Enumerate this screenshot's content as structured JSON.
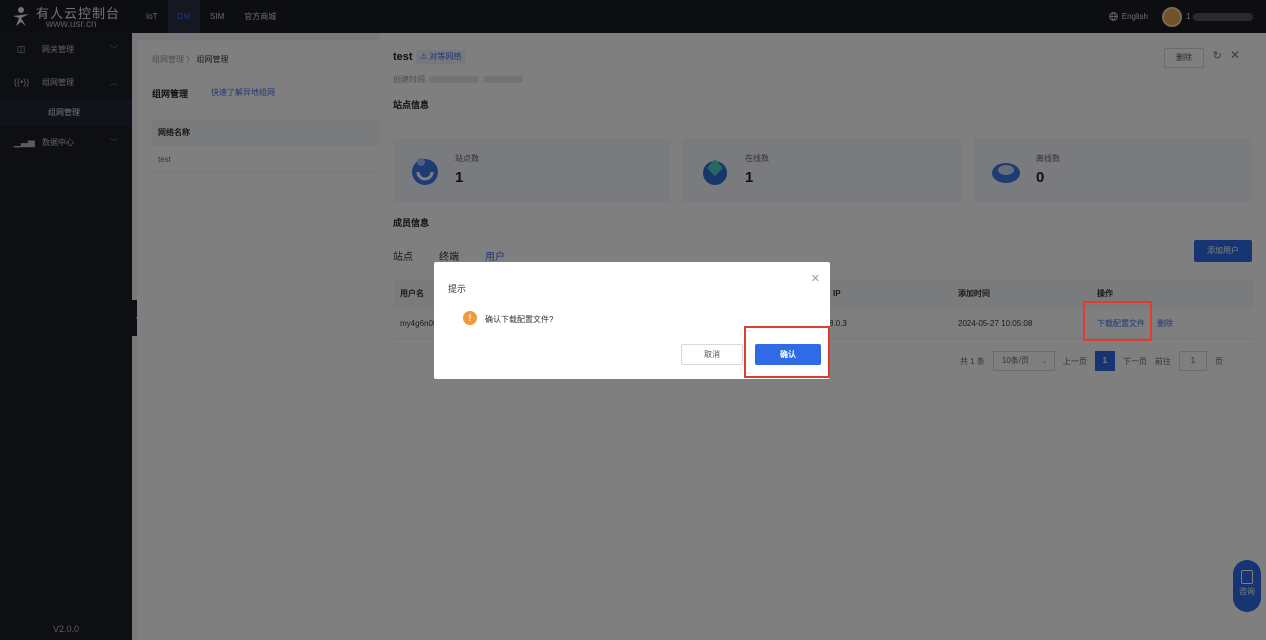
{
  "brand": {
    "title": "有人云控制台",
    "subtitle": "www.usr.cn"
  },
  "topnav": {
    "items": [
      "IoT",
      "DM",
      "SIM",
      "官方商城"
    ],
    "active": "DM"
  },
  "header": {
    "language": "English",
    "user": "1"
  },
  "sidebar": {
    "items": [
      {
        "label": "网关管理",
        "icon": "gateway-icon"
      },
      {
        "label": "组网管理",
        "icon": "network-icon"
      },
      {
        "label": "数据中心",
        "icon": "chart-icon"
      }
    ],
    "sub_item": "组网管理",
    "version": "V2.0.0"
  },
  "main": {
    "breadcrumb": [
      "组网管理",
      "组网管理"
    ],
    "title": "组网管理",
    "help_link": "快速了解异地组网",
    "list_header": "网络名称",
    "list_rows": [
      "test"
    ]
  },
  "drawer": {
    "title": "test",
    "tag": "对等网络",
    "created_label": "创建时间",
    "delete_label": "删除",
    "site_info_title": "站点信息",
    "stats": [
      {
        "label": "站点数",
        "value": "1"
      },
      {
        "label": "在线数",
        "value": "1"
      },
      {
        "label": "离线数",
        "value": "0"
      }
    ],
    "member_info_title": "成员信息",
    "tabs": [
      "站点",
      "终端",
      "用户"
    ],
    "active_tab": "用户",
    "add_user_label": "添加用户",
    "table": {
      "headers": {
        "username": "用户名",
        "ip": "IP",
        "added_time": "添加时间",
        "actions": "操作"
      },
      "rows": [
        {
          "username": "my4g6n0f",
          "ip": "8.0.3",
          "added_time": "2024-05-27 10:05:08",
          "download": "下载配置文件",
          "delete": "删除"
        }
      ]
    },
    "pagination": {
      "total": "共 1 条",
      "page_size": "10条/页",
      "prev": "上一页",
      "page": "1",
      "next": "下一页",
      "goto": "前往",
      "goto_value": "1",
      "page_unit": "页"
    }
  },
  "consult_label": "咨询",
  "dialog": {
    "title": "提示",
    "message": "确认下载配置文件?",
    "cancel": "取消",
    "confirm": "确认"
  },
  "colors": {
    "accent": "#2f6be6",
    "warning": "#f29a38",
    "highlight": "#e43b2f"
  }
}
